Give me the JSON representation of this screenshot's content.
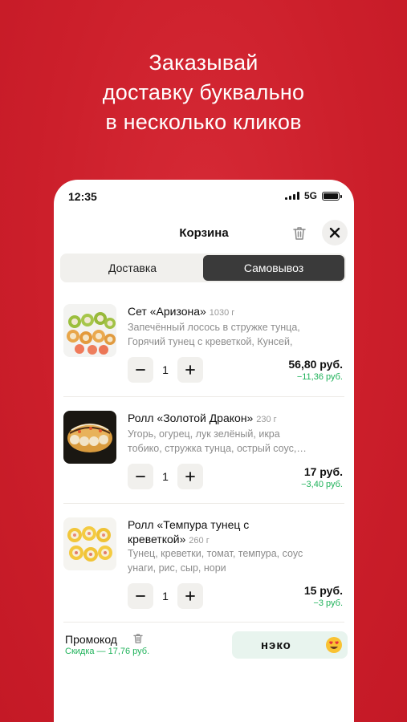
{
  "headline": {
    "line1": "Заказывай",
    "line2": "доставку буквально",
    "line3": "в несколько кликов"
  },
  "status_bar": {
    "time": "12:35",
    "network": "5G"
  },
  "cart": {
    "title": "Корзина",
    "tabs": [
      {
        "label": "Доставка",
        "selected": false
      },
      {
        "label": "Самовывоз",
        "selected": true
      }
    ],
    "items": [
      {
        "title": "Сет «Аризона»",
        "weight": "1030 г",
        "desc_line1": "Запечённый лосось в стружке тунца,",
        "desc_line2": "Горячий тунец с креветкой, Кунсей,",
        "quantity": "1",
        "price": "56,80 руб.",
        "discount": "−11,36 руб."
      },
      {
        "title": "Ролл «Золотой Дракон»",
        "weight": "230 г",
        "desc_line1": "Угорь, огурец, лук зелёный, икра",
        "desc_line2": "тобико, стружка тунца, острый соус,…",
        "quantity": "1",
        "price": "17 руб.",
        "discount": "−3,40 руб."
      },
      {
        "title_line1": "Ролл «Темпура тунец с",
        "title_line2": "креветкой»",
        "weight": "260 г",
        "desc_line1": "Тунец, креветки, томат, темпура, соус",
        "desc_line2": "унаги, рис, сыр, нори",
        "quantity": "1",
        "price": "15 руб.",
        "discount": "−3 руб."
      }
    ],
    "promo": {
      "label": "Промокод",
      "discount": "Скидка — 17,76 руб.",
      "code": "нэко"
    }
  },
  "colors": {
    "background": "#cc1f2b",
    "active_tab": "#3a3a3a",
    "discount_green": "#1fb25a",
    "promo_bg": "#e8f4ee"
  },
  "icons": [
    "signal-icon",
    "battery-icon",
    "trash-icon",
    "close-icon",
    "minus-icon",
    "plus-icon",
    "heart-eyes-emoji-icon"
  ]
}
